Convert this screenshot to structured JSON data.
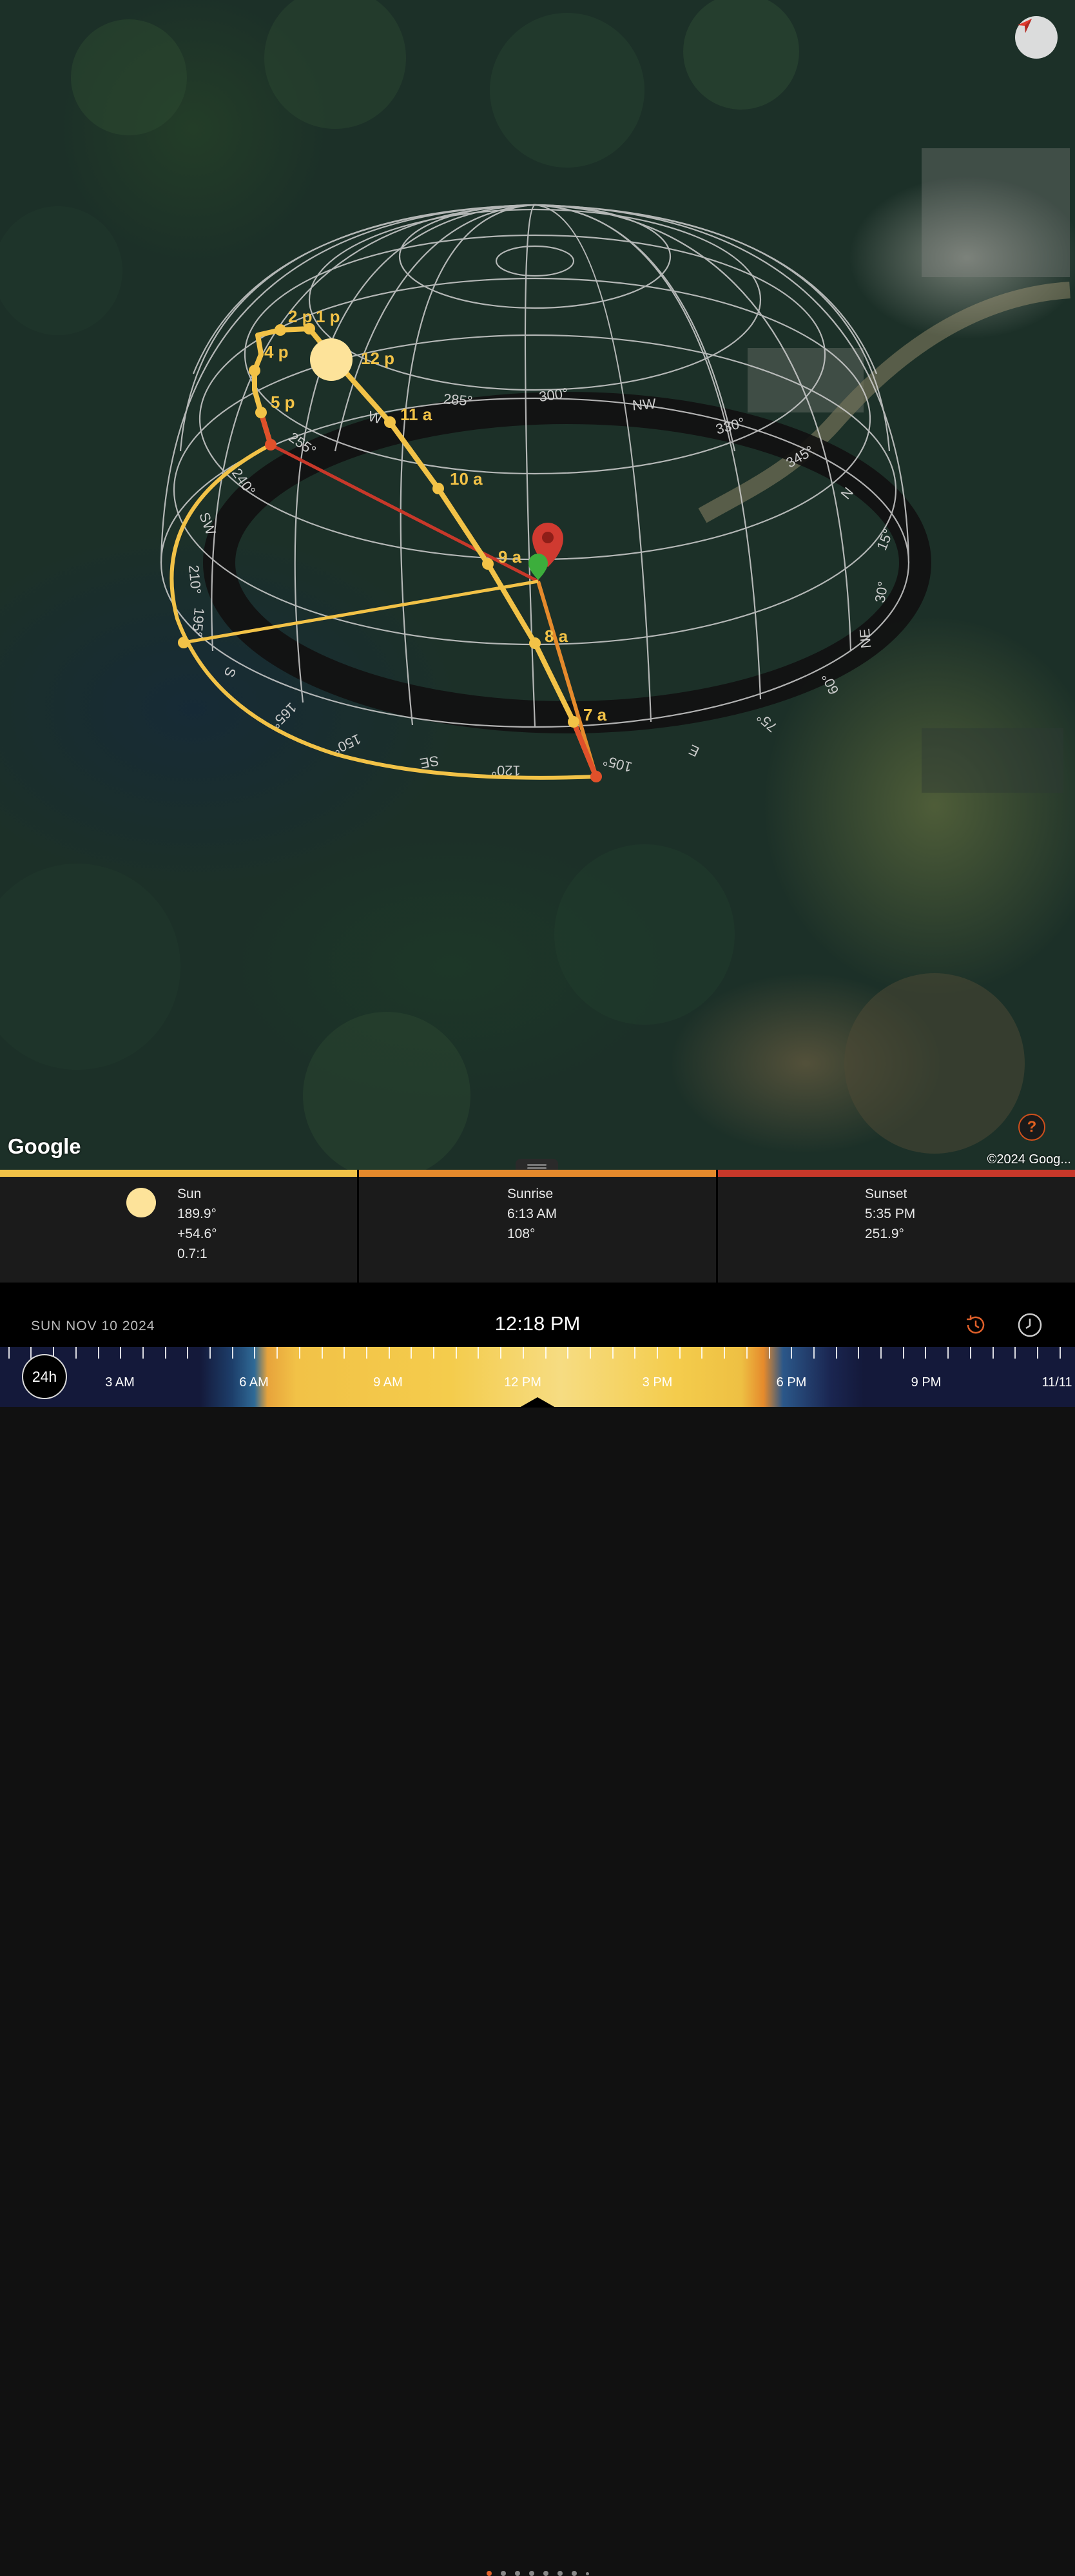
{
  "map": {
    "attribution_logo": "Google",
    "copyright": "©2024 Goog...",
    "compass_icon": "compass-arrow-icon",
    "help_label": "?",
    "hour_markers": [
      "7 a",
      "8 a",
      "9 a",
      "10 a",
      "11 a",
      "12 p",
      "1 p",
      "2 p",
      "4 p",
      "5 p"
    ],
    "bearing_labels": [
      "300°",
      "285°",
      "255°",
      "240°",
      "SW",
      "210°",
      "195°",
      "S",
      "165°",
      "150°",
      "SE",
      "120°",
      "105°",
      "E",
      "75°",
      "60°",
      "NE",
      "30°",
      "15°",
      "N",
      "345°",
      "330°",
      "NW",
      "W"
    ]
  },
  "panels": {
    "sun": {
      "title": "Sun",
      "azimuth": "189.9°",
      "elevation": "+54.6°",
      "shadow_ratio": "0.7:1",
      "color": "#f2c247"
    },
    "sunrise": {
      "title": "Sunrise",
      "time": "6:13 AM",
      "azimuth": "108°",
      "color": "#e58a2c"
    },
    "sunset": {
      "title": "Sunset",
      "time": "5:35 PM",
      "azimuth": "251.9°",
      "color": "#c8382a"
    }
  },
  "pager": {
    "count": 8,
    "active_index": 0
  },
  "timebar": {
    "date": "SUN NOV 10 2024",
    "time": "12:18 PM",
    "history_icon": "history-icon",
    "clock_icon": "clock-icon",
    "toggle_label": "24h",
    "hour_labels": [
      "3 AM",
      "6 AM",
      "9 AM",
      "12 PM",
      "3 PM",
      "6 PM",
      "9 PM",
      "11/11"
    ]
  }
}
